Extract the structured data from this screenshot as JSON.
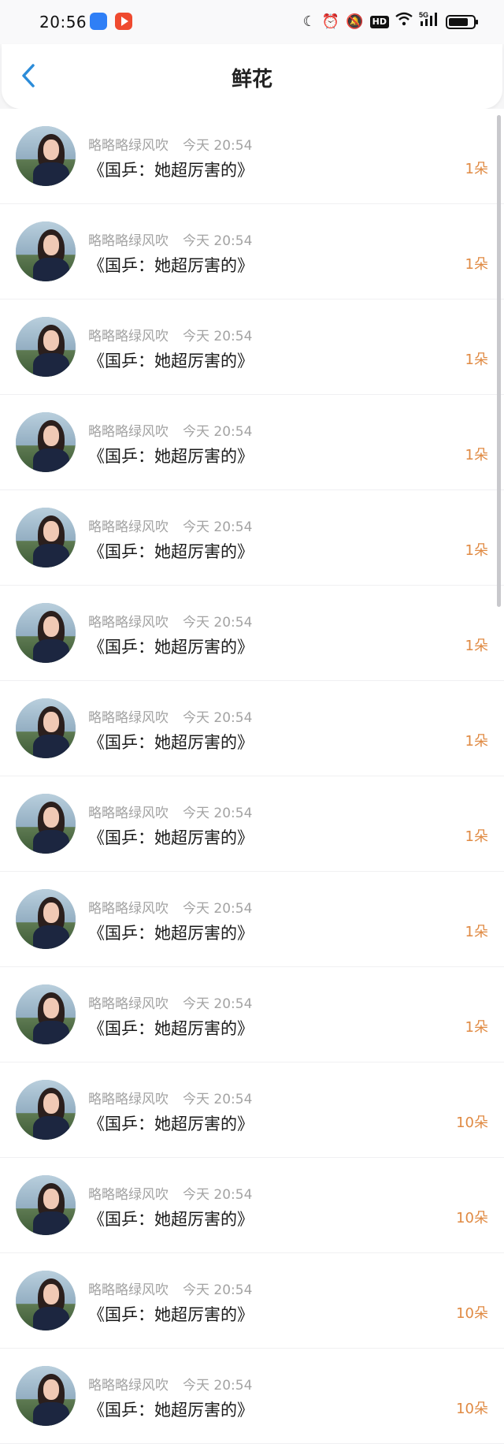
{
  "status_bar": {
    "time": "20:56",
    "icons": [
      "moon-icon",
      "alarm-icon",
      "mute-icon",
      "hd-icon",
      "wifi-icon",
      "5g-signal-icon",
      "battery-icon"
    ],
    "hd": "HD",
    "network": "5G"
  },
  "header": {
    "title": "鲜花",
    "back_icon": "chevron-left-icon",
    "accent": "#2c8cd9"
  },
  "colors": {
    "count": "#e08a43",
    "meta": "#a3a3a3"
  },
  "items": [
    {
      "name": "略略略绿风吹",
      "time": "今天 20:54",
      "title": "《国乒：她超厉害的》",
      "count": "1朵"
    },
    {
      "name": "略略略绿风吹",
      "time": "今天 20:54",
      "title": "《国乒：她超厉害的》",
      "count": "1朵"
    },
    {
      "name": "略略略绿风吹",
      "time": "今天 20:54",
      "title": "《国乒：她超厉害的》",
      "count": "1朵"
    },
    {
      "name": "略略略绿风吹",
      "time": "今天 20:54",
      "title": "《国乒：她超厉害的》",
      "count": "1朵"
    },
    {
      "name": "略略略绿风吹",
      "time": "今天 20:54",
      "title": "《国乒：她超厉害的》",
      "count": "1朵"
    },
    {
      "name": "略略略绿风吹",
      "time": "今天 20:54",
      "title": "《国乒：她超厉害的》",
      "count": "1朵"
    },
    {
      "name": "略略略绿风吹",
      "time": "今天 20:54",
      "title": "《国乒：她超厉害的》",
      "count": "1朵"
    },
    {
      "name": "略略略绿风吹",
      "time": "今天 20:54",
      "title": "《国乒：她超厉害的》",
      "count": "1朵"
    },
    {
      "name": "略略略绿风吹",
      "time": "今天 20:54",
      "title": "《国乒：她超厉害的》",
      "count": "1朵"
    },
    {
      "name": "略略略绿风吹",
      "time": "今天 20:54",
      "title": "《国乒：她超厉害的》",
      "count": "1朵"
    },
    {
      "name": "略略略绿风吹",
      "time": "今天 20:54",
      "title": "《国乒：她超厉害的》",
      "count": "10朵"
    },
    {
      "name": "略略略绿风吹",
      "time": "今天 20:54",
      "title": "《国乒：她超厉害的》",
      "count": "10朵"
    },
    {
      "name": "略略略绿风吹",
      "time": "今天 20:54",
      "title": "《国乒：她超厉害的》",
      "count": "10朵"
    },
    {
      "name": "略略略绿风吹",
      "time": "今天 20:54",
      "title": "《国乒：她超厉害的》",
      "count": "10朵"
    }
  ]
}
